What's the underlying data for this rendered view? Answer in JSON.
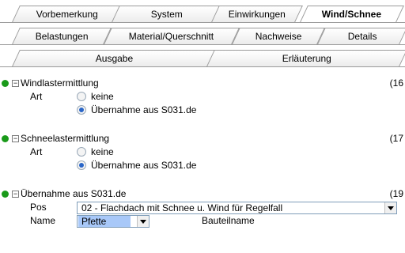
{
  "tabs_row1": [
    {
      "label": "Vorbemerkung",
      "active": false
    },
    {
      "label": "System",
      "active": false
    },
    {
      "label": "Einwirkungen",
      "active": false
    },
    {
      "label": "Wind/Schnee",
      "active": true
    }
  ],
  "tabs_row2": [
    {
      "label": "Belastungen"
    },
    {
      "label": "Material/Querschnitt"
    },
    {
      "label": "Nachweise"
    },
    {
      "label": "Details"
    }
  ],
  "tabs_row3": [
    {
      "label": "Ausgabe"
    },
    {
      "label": "Erläuterung"
    }
  ],
  "sections": [
    {
      "title": "Windlastermittlung",
      "number": "(16",
      "field_label": "Art",
      "options": [
        {
          "label": "keine",
          "selected": false
        },
        {
          "label": "Übernahme aus S031.de",
          "selected": true
        }
      ]
    },
    {
      "title": "Schneelastermittlung",
      "number": "(17",
      "field_label": "Art",
      "options": [
        {
          "label": "keine",
          "selected": false
        },
        {
          "label": "Übernahme aus S031.de",
          "selected": true
        }
      ]
    },
    {
      "title": "Übernahme aus S031.de",
      "number": "(19",
      "pos_label": "Pos",
      "pos_value": "02 - Flachdach mit Schnee u. Wind für Regelfall",
      "name_label": "Name",
      "name_value": "Pfette",
      "name_hint": "Bauteilname"
    }
  ],
  "colors": {
    "status_dot": "#1a9a1a",
    "selection_bg": "#a8c8f8",
    "radio_selected": "#2a66c8"
  },
  "icons": {
    "status": "green-dot-icon",
    "collapse": "minus-box-icon",
    "dropdown": "chevron-down-icon"
  }
}
